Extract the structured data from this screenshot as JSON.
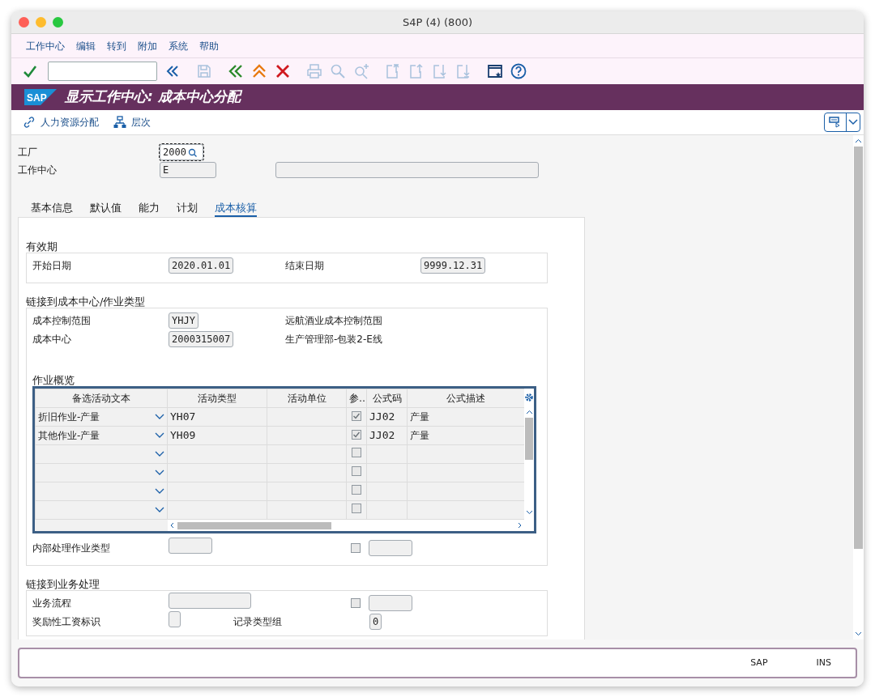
{
  "window": {
    "title": "S4P (4) (800)"
  },
  "menu": [
    "工作中心",
    "编辑",
    "转到",
    "附加",
    "系统",
    "帮助"
  ],
  "toolbar": [
    {
      "kind": "check",
      "disabled": false
    },
    {
      "kind": "command-field"
    },
    {
      "kind": "collapse",
      "disabled": false
    },
    {
      "kind": "save",
      "disabled": true
    },
    {
      "kind": "back",
      "disabled": false
    },
    {
      "kind": "exit",
      "disabled": false
    },
    {
      "kind": "cancel",
      "disabled": false
    },
    {
      "kind": "print",
      "disabled": true
    },
    {
      "kind": "find",
      "disabled": true
    },
    {
      "kind": "find-next",
      "disabled": true
    },
    {
      "kind": "first-page",
      "disabled": true
    },
    {
      "kind": "prev-page",
      "disabled": true
    },
    {
      "kind": "next-page",
      "disabled": true
    },
    {
      "kind": "last-page",
      "disabled": true
    },
    {
      "kind": "layout",
      "disabled": false
    },
    {
      "kind": "help",
      "disabled": false
    }
  ],
  "logo": "SAP",
  "title": "显示工作中心: 成本中心分配",
  "app_toolbar": [
    {
      "kind": "link",
      "label": "人力资源分配"
    },
    {
      "kind": "hierarchy",
      "label": "层次"
    }
  ],
  "header": [
    {
      "label": "工厂",
      "value": "2000",
      "focused": true
    },
    {
      "label": "工作中心",
      "value": "E",
      "focused": false
    }
  ],
  "tabs": [
    {
      "label": "基本信息",
      "selected": false
    },
    {
      "label": "默认值",
      "selected": false
    },
    {
      "label": "能力",
      "selected": false
    },
    {
      "label": "计划",
      "selected": false
    },
    {
      "label": "成本核算",
      "selected": true
    }
  ],
  "validity": {
    "title": "有效期",
    "start_label": "开始日期",
    "start": "2020.01.01",
    "end_label": "结束日期",
    "end": "9999.12.31"
  },
  "cost_link": {
    "title": "链接到成本中心/作业类型",
    "rows": [
      {
        "label": "成本控制范围",
        "value": "YHJY",
        "description": "远航酒业成本控制范围"
      },
      {
        "label": "成本中心",
        "value": "2000315007",
        "description": "生产管理部-包装2-E线"
      }
    ],
    "activities": {
      "title": "作业概览",
      "columns": [
        "备选活动文本",
        "活动类型",
        "活动单位",
        "参…",
        "公式码",
        "公式描述"
      ],
      "rows": [
        {
          "alt_text": "折旧作业-产量",
          "activity_type": "YH07",
          "checked": true,
          "formula": "JJ02",
          "formula_desc": "产量"
        },
        {
          "alt_text": "其他作业-产量",
          "activity_type": "YH09",
          "checked": true,
          "formula": "JJ02",
          "formula_desc": "产量"
        },
        {
          "checked": false
        },
        {
          "checked": false
        },
        {
          "checked": false
        },
        {
          "checked": false
        }
      ]
    },
    "internal": {
      "label": "内部处理作业类型",
      "checked": false
    }
  },
  "business": {
    "title": "链接到业务处理",
    "process_label": "业务流程",
    "process_checked": false,
    "bonus_label": "奖励性工资标识",
    "record_label": "记录类型组",
    "record_value": "0"
  },
  "status_bar": [
    "SAP",
    "INS"
  ]
}
